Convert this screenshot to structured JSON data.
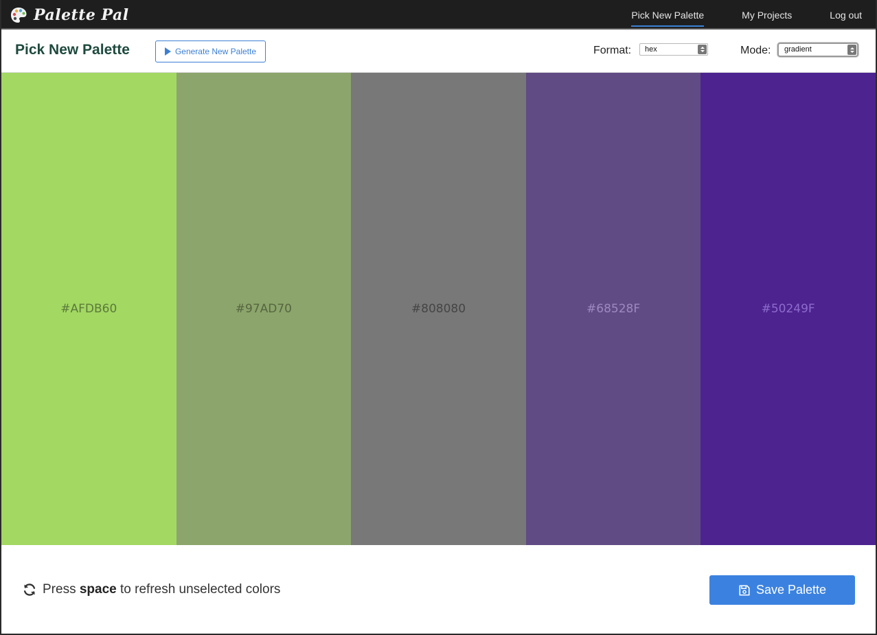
{
  "app": {
    "brand": "Palette Pal"
  },
  "nav": {
    "items": [
      {
        "label": "Pick New Palette",
        "active": true
      },
      {
        "label": "My Projects",
        "active": false
      },
      {
        "label": "Log out",
        "active": false
      }
    ]
  },
  "toolbar": {
    "title": "Pick New Palette",
    "generate_label": "Generate New Palette",
    "format_label": "Format:",
    "format_value": "hex",
    "mode_label": "Mode:",
    "mode_value": "gradient"
  },
  "swatches": [
    {
      "hex": "#AFDB60",
      "background": "#a3d863",
      "text_color": "#5b7a3a"
    },
    {
      "hex": "#97AD70",
      "background": "#8ca56c",
      "text_color": "#55653f"
    },
    {
      "hex": "#808080",
      "background": "#787878",
      "text_color": "#454545"
    },
    {
      "hex": "#68528F",
      "background": "#614b84",
      "text_color": "#9d8ac0"
    },
    {
      "hex": "#50249F",
      "background": "#4d238f",
      "text_color": "#8d6ccc"
    }
  ],
  "footer": {
    "hint_prefix": "Press",
    "hint_key": "space",
    "hint_suffix": "to refresh unselected colors",
    "save_label": "Save Palette"
  },
  "colors": {
    "accent": "#3b82e0",
    "nav_bg": "#1e1e1e",
    "title": "#1e4a3e"
  }
}
